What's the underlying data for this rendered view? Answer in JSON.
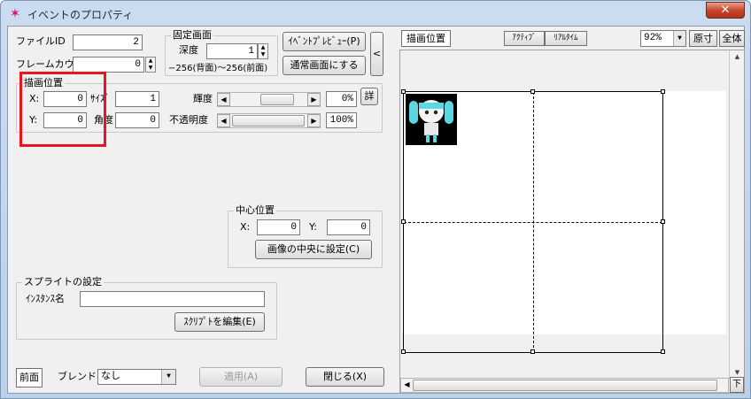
{
  "window": {
    "title": "イベントのプロパティ",
    "close": "✕"
  },
  "left": {
    "file_id_label": "ファイルID",
    "file_id_value": "2",
    "frame_count_label": "フレームカウント",
    "frame_count_value": "0",
    "fixed_screen": {
      "title": "固定画面",
      "depth_label": "深度",
      "depth_value": "1",
      "range_text": "−256(背面)〜256(前面)"
    },
    "event_preview_btn": "ｲﾍﾞﾝﾄﾌﾟﾚﾋﾞｭｰ(P)",
    "normal_screen_btn": "通常画面にする",
    "collapse_btn": "<",
    "draw_position": {
      "title": "描画位置",
      "x_label": "X:",
      "x_value": "0",
      "y_label": "Y:",
      "y_value": "0",
      "size_label": "ｻｲｽﾞ",
      "size_value": "1",
      "angle_label": "角度",
      "angle_value": "0",
      "brightness_label": "輝度",
      "brightness_value": "0%",
      "opacity_label": "不透明度",
      "opacity_value": "100%",
      "detail_btn": "詳"
    },
    "center_position": {
      "title": "中心位置",
      "x_label": "X:",
      "x_value": "0",
      "y_label": "Y:",
      "y_value": "0",
      "center_btn": "画像の中央に設定(C)"
    },
    "sprite_settings": {
      "title": "スプライトの設定",
      "instance_label": "ｲﾝｽﾀﾝｽ名",
      "instance_value": "",
      "edit_script_btn": "ｽｸﾘﾌﾟﾄを編集(E)"
    },
    "front_btn": "前面",
    "blend_label": "ブレンド",
    "blend_value": "なし",
    "apply_btn": "適用(A)",
    "close_btn": "閉じる(X)"
  },
  "right": {
    "tab_draw_position": "描画位置",
    "tab_active": "ｱｸﾃｨﾌﾞ",
    "tab_realtime": "ﾘｱﾙﾀｲﾑ",
    "zoom_value": "92%",
    "original_btn": "原寸",
    "whole_btn": "全体",
    "down_btn": "下"
  },
  "colors": {
    "accent_red": "#e8141e",
    "character_hair": "#5cd6e0"
  },
  "icons": {
    "title": "star-icon",
    "spin": "spin-arrows-icon",
    "scroll_left": "arrow-left-icon",
    "scroll_right": "arrow-right-icon",
    "dropdown": "chevron-down-icon"
  }
}
